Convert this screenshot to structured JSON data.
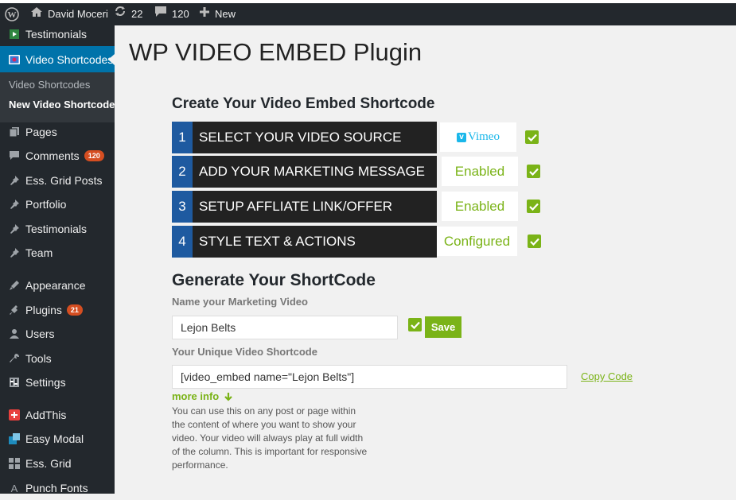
{
  "adminbar": {
    "site_name": "David Moceri",
    "updates_count": "22",
    "comments_count": "120",
    "new_label": "New"
  },
  "sidebar": {
    "items": [
      {
        "label": "Testimonials",
        "icon": "testimonials-icon"
      },
      {
        "label": "Video Shortcodes",
        "icon": "video-shortcodes-icon"
      },
      {
        "label": "Pages",
        "icon": "pages-icon"
      },
      {
        "label": "Comments",
        "icon": "comments-icon",
        "badge": "120"
      },
      {
        "label": "Ess. Grid Posts",
        "icon": "pin-icon"
      },
      {
        "label": "Portfolio",
        "icon": "pin-icon"
      },
      {
        "label": "Testimonials",
        "icon": "pin-icon"
      },
      {
        "label": "Team",
        "icon": "pin-icon"
      },
      {
        "label": "Appearance",
        "icon": "appearance-icon"
      },
      {
        "label": "Plugins",
        "icon": "plugins-icon",
        "badge": "21"
      },
      {
        "label": "Users",
        "icon": "users-icon"
      },
      {
        "label": "Tools",
        "icon": "tools-icon"
      },
      {
        "label": "Settings",
        "icon": "settings-icon"
      },
      {
        "label": "AddThis",
        "icon": "addthis-icon"
      },
      {
        "label": "Easy Modal",
        "icon": "easy-modal-icon"
      },
      {
        "label": "Ess. Grid",
        "icon": "grid-icon"
      },
      {
        "label": "Punch Fonts",
        "icon": "fonts-icon"
      }
    ],
    "submenu": [
      {
        "label": "Video Shortcodes"
      },
      {
        "label": "New Video Shortcode"
      }
    ]
  },
  "main": {
    "page_title": "WP VIDEO EMBED Plugin",
    "create_heading": "Create Your Video Embed Shortcode",
    "steps": [
      {
        "number": "1",
        "label": "SELECT YOUR VIDEO SOURCE",
        "status": "Vimeo"
      },
      {
        "number": "2",
        "label": "ADD YOUR MARKETING MESSAGE",
        "status": "Enabled"
      },
      {
        "number": "3",
        "label": "SETUP AFFLIATE LINK/OFFER",
        "status": "Enabled"
      },
      {
        "number": "4",
        "label": "STYLE TEXT & ACTIONS",
        "status": "Configured"
      }
    ],
    "generate_heading": "Generate Your ShortCode",
    "name_label": "Name your Marketing Video",
    "name_value": "Lejon Belts",
    "save_label": "Save",
    "shortcode_label": "Your Unique Video Shortcode",
    "shortcode_value": "[video_embed name=\"Lejon Belts\"]",
    "copy_code_label": "Copy Code",
    "more_info_label": "more info",
    "more_info_text": "You can use this on any post or page within the content of where you want to show your video. Your video will always play at full width of the column. This is important for responsive performance."
  },
  "colors": {
    "accent_green": "#7ab317",
    "step_blue": "#1e5aa0",
    "admin_dark": "#23282d",
    "active_blue": "#0073aa",
    "badge_orange": "#d54e21",
    "vimeo_blue": "#1ab7ea"
  }
}
